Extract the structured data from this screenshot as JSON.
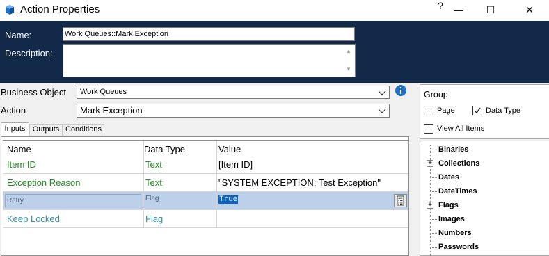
{
  "window": {
    "title": "Action Properties",
    "controls": {
      "help": "?",
      "minimize": "—",
      "maximize": "☐",
      "close": "✕"
    }
  },
  "header": {
    "name_label": "Name:",
    "name_value": "Work Queues::Mark Exception",
    "description_label": "Description:",
    "description_value": ""
  },
  "form": {
    "business_object_label": "Business Object",
    "business_object_value": "Work Queues",
    "action_label": "Action",
    "action_value": "Mark Exception"
  },
  "tabs": [
    {
      "label": "Inputs",
      "active": true
    },
    {
      "label": "Outputs",
      "active": false
    },
    {
      "label": "Conditions",
      "active": false
    }
  ],
  "grid": {
    "headers": {
      "name": "Name",
      "type": "Data Type",
      "value": "Value"
    },
    "rows": [
      {
        "name": "Item ID",
        "type": "Text",
        "value": "[Item ID]"
      },
      {
        "name": "Exception Reason",
        "type": "Text",
        "value": "\"SYSTEM EXCEPTION: Test Exception\""
      },
      {
        "name": "Retry",
        "type": "Flag",
        "value": "True"
      },
      {
        "name": "Keep Locked",
        "type": "Flag",
        "value": ""
      }
    ]
  },
  "group": {
    "label": "Group:",
    "options": [
      {
        "label": "Page",
        "checked": false
      },
      {
        "label": "Data Type",
        "checked": true
      },
      {
        "label": "View All Items",
        "checked": false
      }
    ]
  },
  "tree": [
    {
      "label": "Binaries",
      "expandable": false
    },
    {
      "label": "Collections",
      "expandable": true
    },
    {
      "label": "Dates",
      "expandable": false
    },
    {
      "label": "DateTimes",
      "expandable": false
    },
    {
      "label": "Flags",
      "expandable": true
    },
    {
      "label": "Images",
      "expandable": false
    },
    {
      "label": "Numbers",
      "expandable": false
    },
    {
      "label": "Passwords",
      "expandable": false
    }
  ],
  "colors": {
    "header_bg": "#12294a",
    "green_text": "#238a23",
    "teal_text": "#3a8ea1",
    "selection_bg": "#bdd0ea",
    "value_highlight": "#0a64c8",
    "info_icon": "#1f6fc5"
  }
}
